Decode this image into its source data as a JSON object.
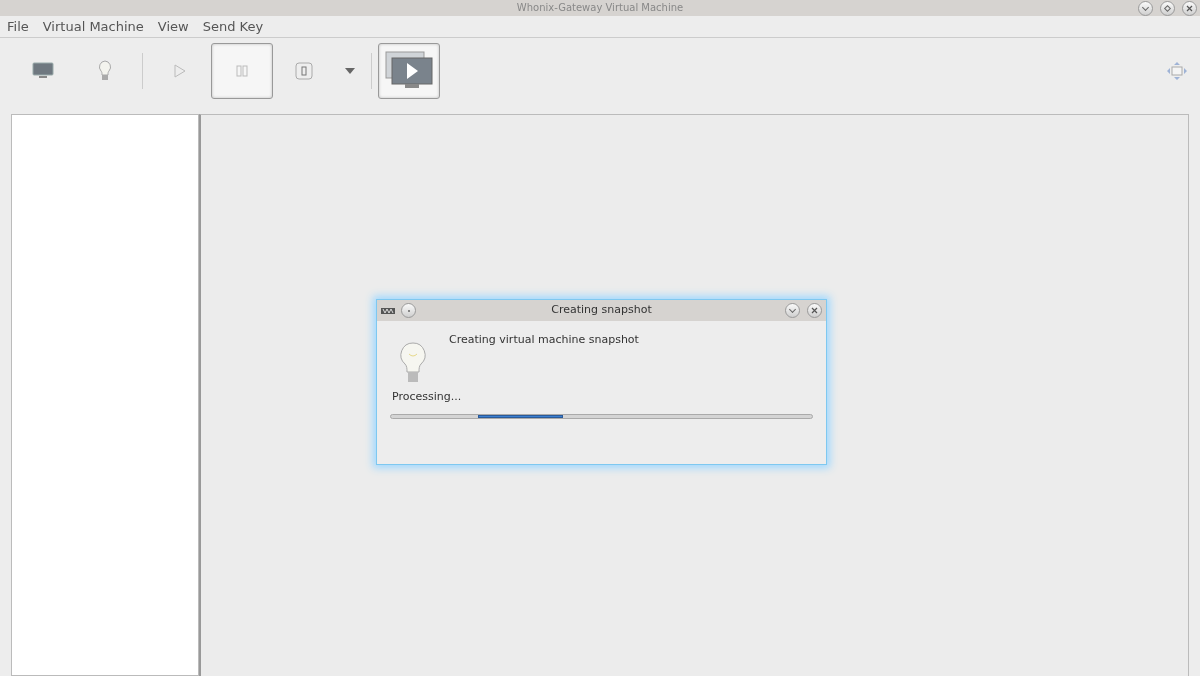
{
  "window": {
    "title": "Whonix-Gateway Virtual Machine"
  },
  "menu": [
    "File",
    "Virtual Machine",
    "View",
    "Send Key"
  ],
  "toolbar": [
    [
      {
        "kind": "monitor",
        "pressed": false
      },
      {
        "kind": "bulb",
        "pressed": false
      }
    ],
    [
      {
        "kind": "play",
        "pressed": false
      },
      {
        "kind": "pause",
        "pressed": true
      },
      {
        "kind": "power",
        "pressed": false
      },
      {
        "kind": "dropdown",
        "pressed": false
      }
    ],
    [
      {
        "kind": "console",
        "pressed": true
      }
    ]
  ],
  "dialog": {
    "title": "Creating snapshot",
    "message": "Creating virtual machine snapshot",
    "status": "Processing..."
  }
}
